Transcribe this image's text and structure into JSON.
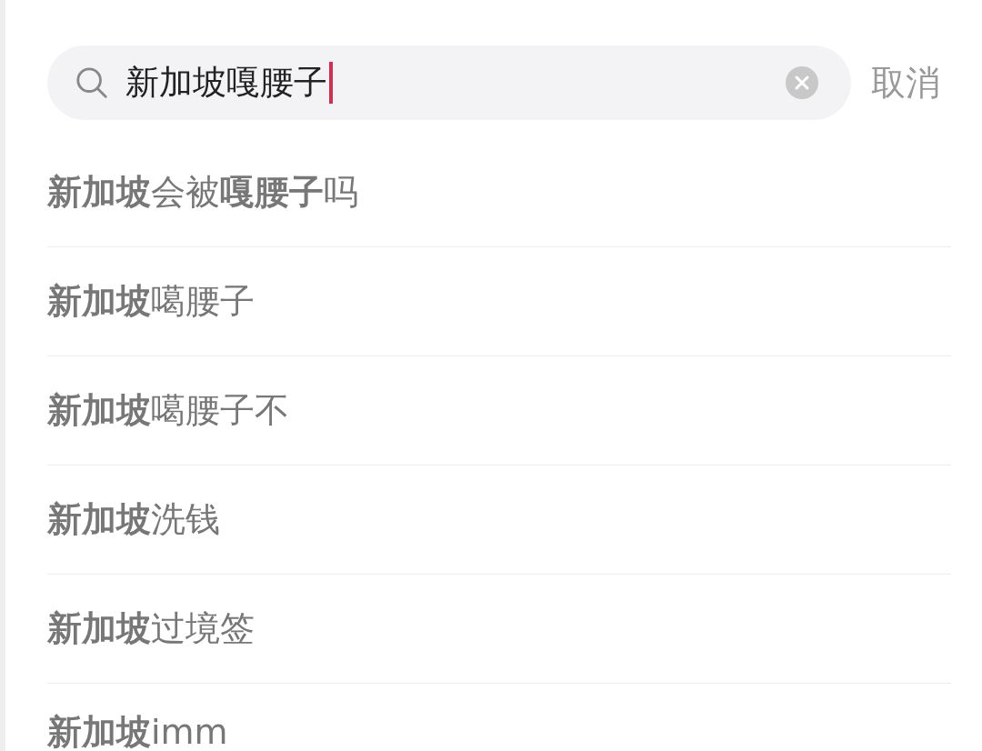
{
  "search": {
    "value": "新加坡嘎腰子",
    "cancel": "取消"
  },
  "suggestions": [
    {
      "text": "**新加坡**会被**嘎腰子**吗"
    },
    {
      "text": "**新加坡**噶腰子"
    },
    {
      "text": "**新加坡**噶腰子不"
    },
    {
      "text": "**新加坡**洗钱"
    },
    {
      "text": "**新加坡**过境签"
    },
    {
      "text": "**新加坡**imm"
    }
  ]
}
